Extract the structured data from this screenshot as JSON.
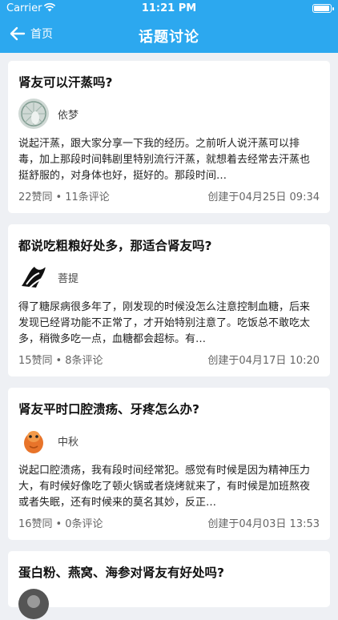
{
  "status": {
    "carrier": "Carrier",
    "time": "11:21 PM"
  },
  "nav": {
    "back_label": "首页",
    "title": "话题讨论"
  },
  "posts": [
    {
      "title": "肾友可以汗蒸吗?",
      "author": "依梦",
      "excerpt": "说起汗蒸，跟大家分享一下我的经历。之前听人说汗蒸可以排毒，加上那段时间韩剧里特别流行汗蒸，就想着去经常去汗蒸也挺舒服的，对身体也好，挺好的。那段时间…",
      "likes": "22赞同",
      "comments": "11条评论",
      "created": "创建于04月25日 09:34"
    },
    {
      "title": "都说吃粗粮好处多，那适合肾友吗?",
      "author": "菩提",
      "excerpt": "得了糖尿病很多年了，刚发现的时候没怎么注意控制血糖，后来发现已经肾功能不正常了，才开始特别注意了。吃饭总不敢吃太多，稍微多吃一点，血糖都会超标。有…",
      "likes": "15赞同",
      "comments": "8条评论",
      "created": "创建于04月17日 10:20"
    },
    {
      "title": "肾友平时口腔溃疡、牙疼怎么办?",
      "author": "中秋",
      "excerpt": "说起口腔溃疡，我有段时间经常犯。感觉有时候是因为精神压力大，有时候好像吃了顿火锅或者烧烤就来了，有时候是加班熬夜或者失眠，还有时候来的莫名其妙，反正…",
      "likes": "16赞同",
      "comments": "0条评论",
      "created": "创建于04月03日 13:53"
    },
    {
      "title": "蛋白粉、燕窝、海参对肾友有好处吗?"
    }
  ],
  "colors": {
    "accent": "#2ca8ef",
    "background": "#eef0f4"
  },
  "icons": {
    "back": "arrow-left-icon",
    "wifi": "wifi-icon",
    "battery": "battery-icon"
  }
}
